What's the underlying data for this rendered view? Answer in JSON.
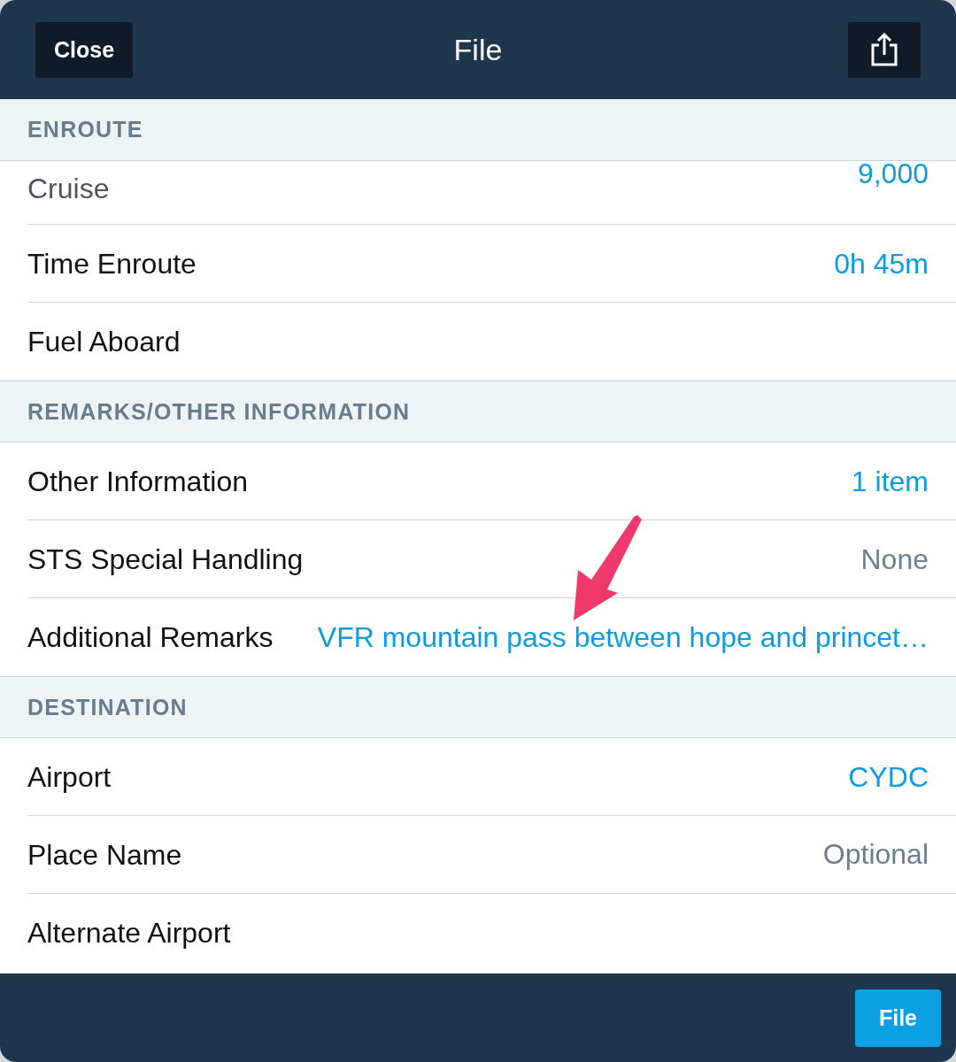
{
  "header": {
    "close_button": "Close",
    "title": "File"
  },
  "sections": [
    {
      "title": "ENROUTE",
      "rows": [
        {
          "kind": "detail",
          "sublabel": "Cruise",
          "value": "9,000"
        },
        {
          "kind": "detail",
          "label": "Time Enroute",
          "value": "0h 45m"
        },
        {
          "kind": "plain",
          "label": "Fuel Aboard"
        }
      ]
    },
    {
      "title": "REMARKS/OTHER INFORMATION",
      "rows": [
        {
          "kind": "detail",
          "label": "Other Information",
          "value": "1 item"
        },
        {
          "kind": "muted",
          "label": "STS Special Handling",
          "value": "None"
        },
        {
          "kind": "detail",
          "label": "Additional Remarks",
          "value": "VFR mountain pass between hope and princet…"
        }
      ]
    },
    {
      "title": "DESTINATION",
      "rows": [
        {
          "kind": "detail",
          "label": "Airport",
          "value": "CYDC"
        },
        {
          "kind": "field",
          "label": "Place Name",
          "placeholder": "Optional"
        },
        {
          "kind": "plain",
          "label": "Alternate Airport"
        }
      ]
    }
  ],
  "footer": {
    "file_button": "File"
  }
}
